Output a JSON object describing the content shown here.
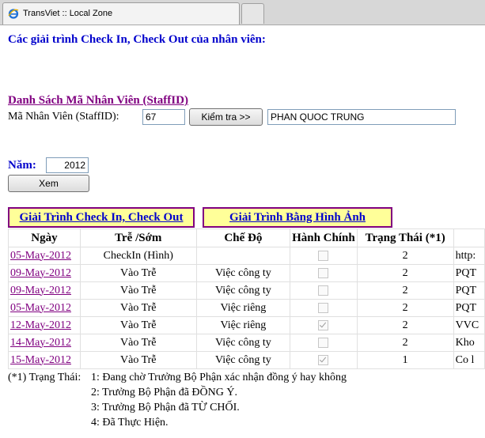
{
  "browser": {
    "tab_title": "TransViet :: Local Zone"
  },
  "page": {
    "header": "Các giải trình Check In, Check Out của nhân viên:",
    "section_title": "Danh Sách Mã Nhân Viên (StaffID)",
    "staff_label": "Mã Nhân Viên (StaffID):",
    "staff_id": "67",
    "check_button": "Kiểm tra >>",
    "staff_name": "PHAN QUOC TRUNG",
    "year_label": "Năm:",
    "year": "2012",
    "view_button": "Xem",
    "tab1": "Giải Trình Check In, Check Out",
    "tab2": "Giải Trình Bằng Hình Ảnh"
  },
  "table": {
    "headers": [
      "Ngày",
      "Trễ /Sớm",
      "Chế Độ",
      "Hành Chính",
      "Trạng Thái (*1)",
      ""
    ],
    "rows": [
      {
        "date": "05-May-2012",
        "type": "CheckIn (Hình)",
        "mode": "",
        "admin": false,
        "status": "2",
        "info": "http:"
      },
      {
        "date": "09-May-2012",
        "type": "Vào Trễ",
        "mode": "Việc công ty",
        "admin": false,
        "status": "2",
        "info": "PQT"
      },
      {
        "date": "09-May-2012",
        "type": "Vào Trễ",
        "mode": "Việc công ty",
        "admin": false,
        "status": "2",
        "info": "PQT"
      },
      {
        "date": "05-May-2012",
        "type": "Vào Trễ",
        "mode": "Việc riêng",
        "admin": false,
        "status": "2",
        "info": "PQT"
      },
      {
        "date": "12-May-2012",
        "type": "Vào Trễ",
        "mode": "Việc riêng",
        "admin": true,
        "status": "2",
        "info": "VVC"
      },
      {
        "date": "14-May-2012",
        "type": "Vào Trễ",
        "mode": "Việc công ty",
        "admin": false,
        "status": "2",
        "info": "Kho"
      },
      {
        "date": "15-May-2012",
        "type": "Vào Trễ",
        "mode": "Việc công ty",
        "admin": true,
        "status": "1",
        "info": "Co l"
      }
    ]
  },
  "notes": {
    "label": "(*1) Trạng Thái:",
    "lines": [
      "1: Đang chờ Trưởng Bộ Phận xác nhận đồng ý hay không",
      "2: Trưởng Bộ Phận đã ĐỒNG Ý.",
      "3: Trưởng Bộ Phận đã TỪ CHỐI.",
      "4: Đã Thực Hiện."
    ]
  }
}
